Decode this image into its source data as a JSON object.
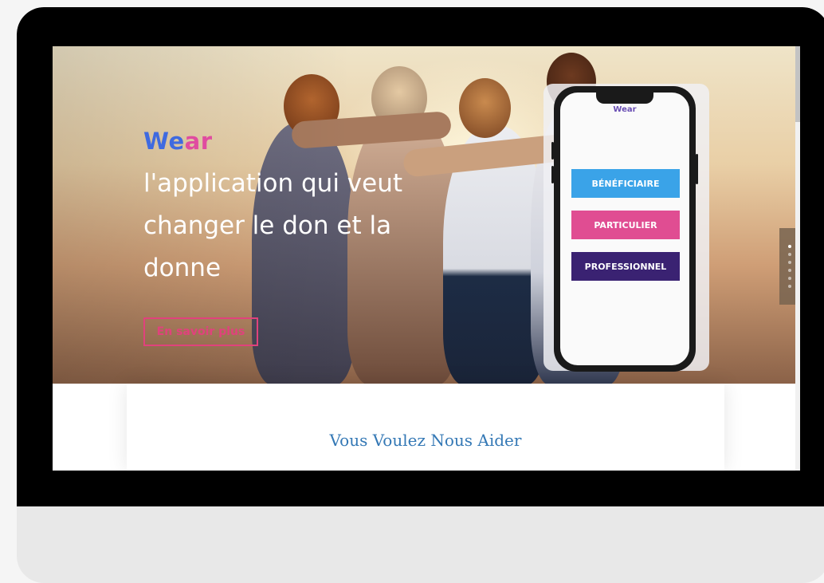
{
  "hero": {
    "brand_part1": "We",
    "brand_part2": "ar",
    "tagline": "l'application qui veut changer le don et la donne",
    "cta_label": "En savoir plus"
  },
  "phone": {
    "brand": "Wear",
    "buttons": [
      "BÉNÉFICIAIRE",
      "PARTICULIER",
      "PROFESSIONNEL"
    ]
  },
  "section": {
    "title": "Vous Voulez Nous Aider"
  },
  "colors": {
    "brand_blue": "#3f6ae0",
    "brand_pink": "#e04ca0",
    "btn_beneficiaire": "#3aa3e8",
    "btn_particulier": "#e04d92",
    "btn_professionnel": "#3a2272",
    "section_title": "#3478b5"
  }
}
